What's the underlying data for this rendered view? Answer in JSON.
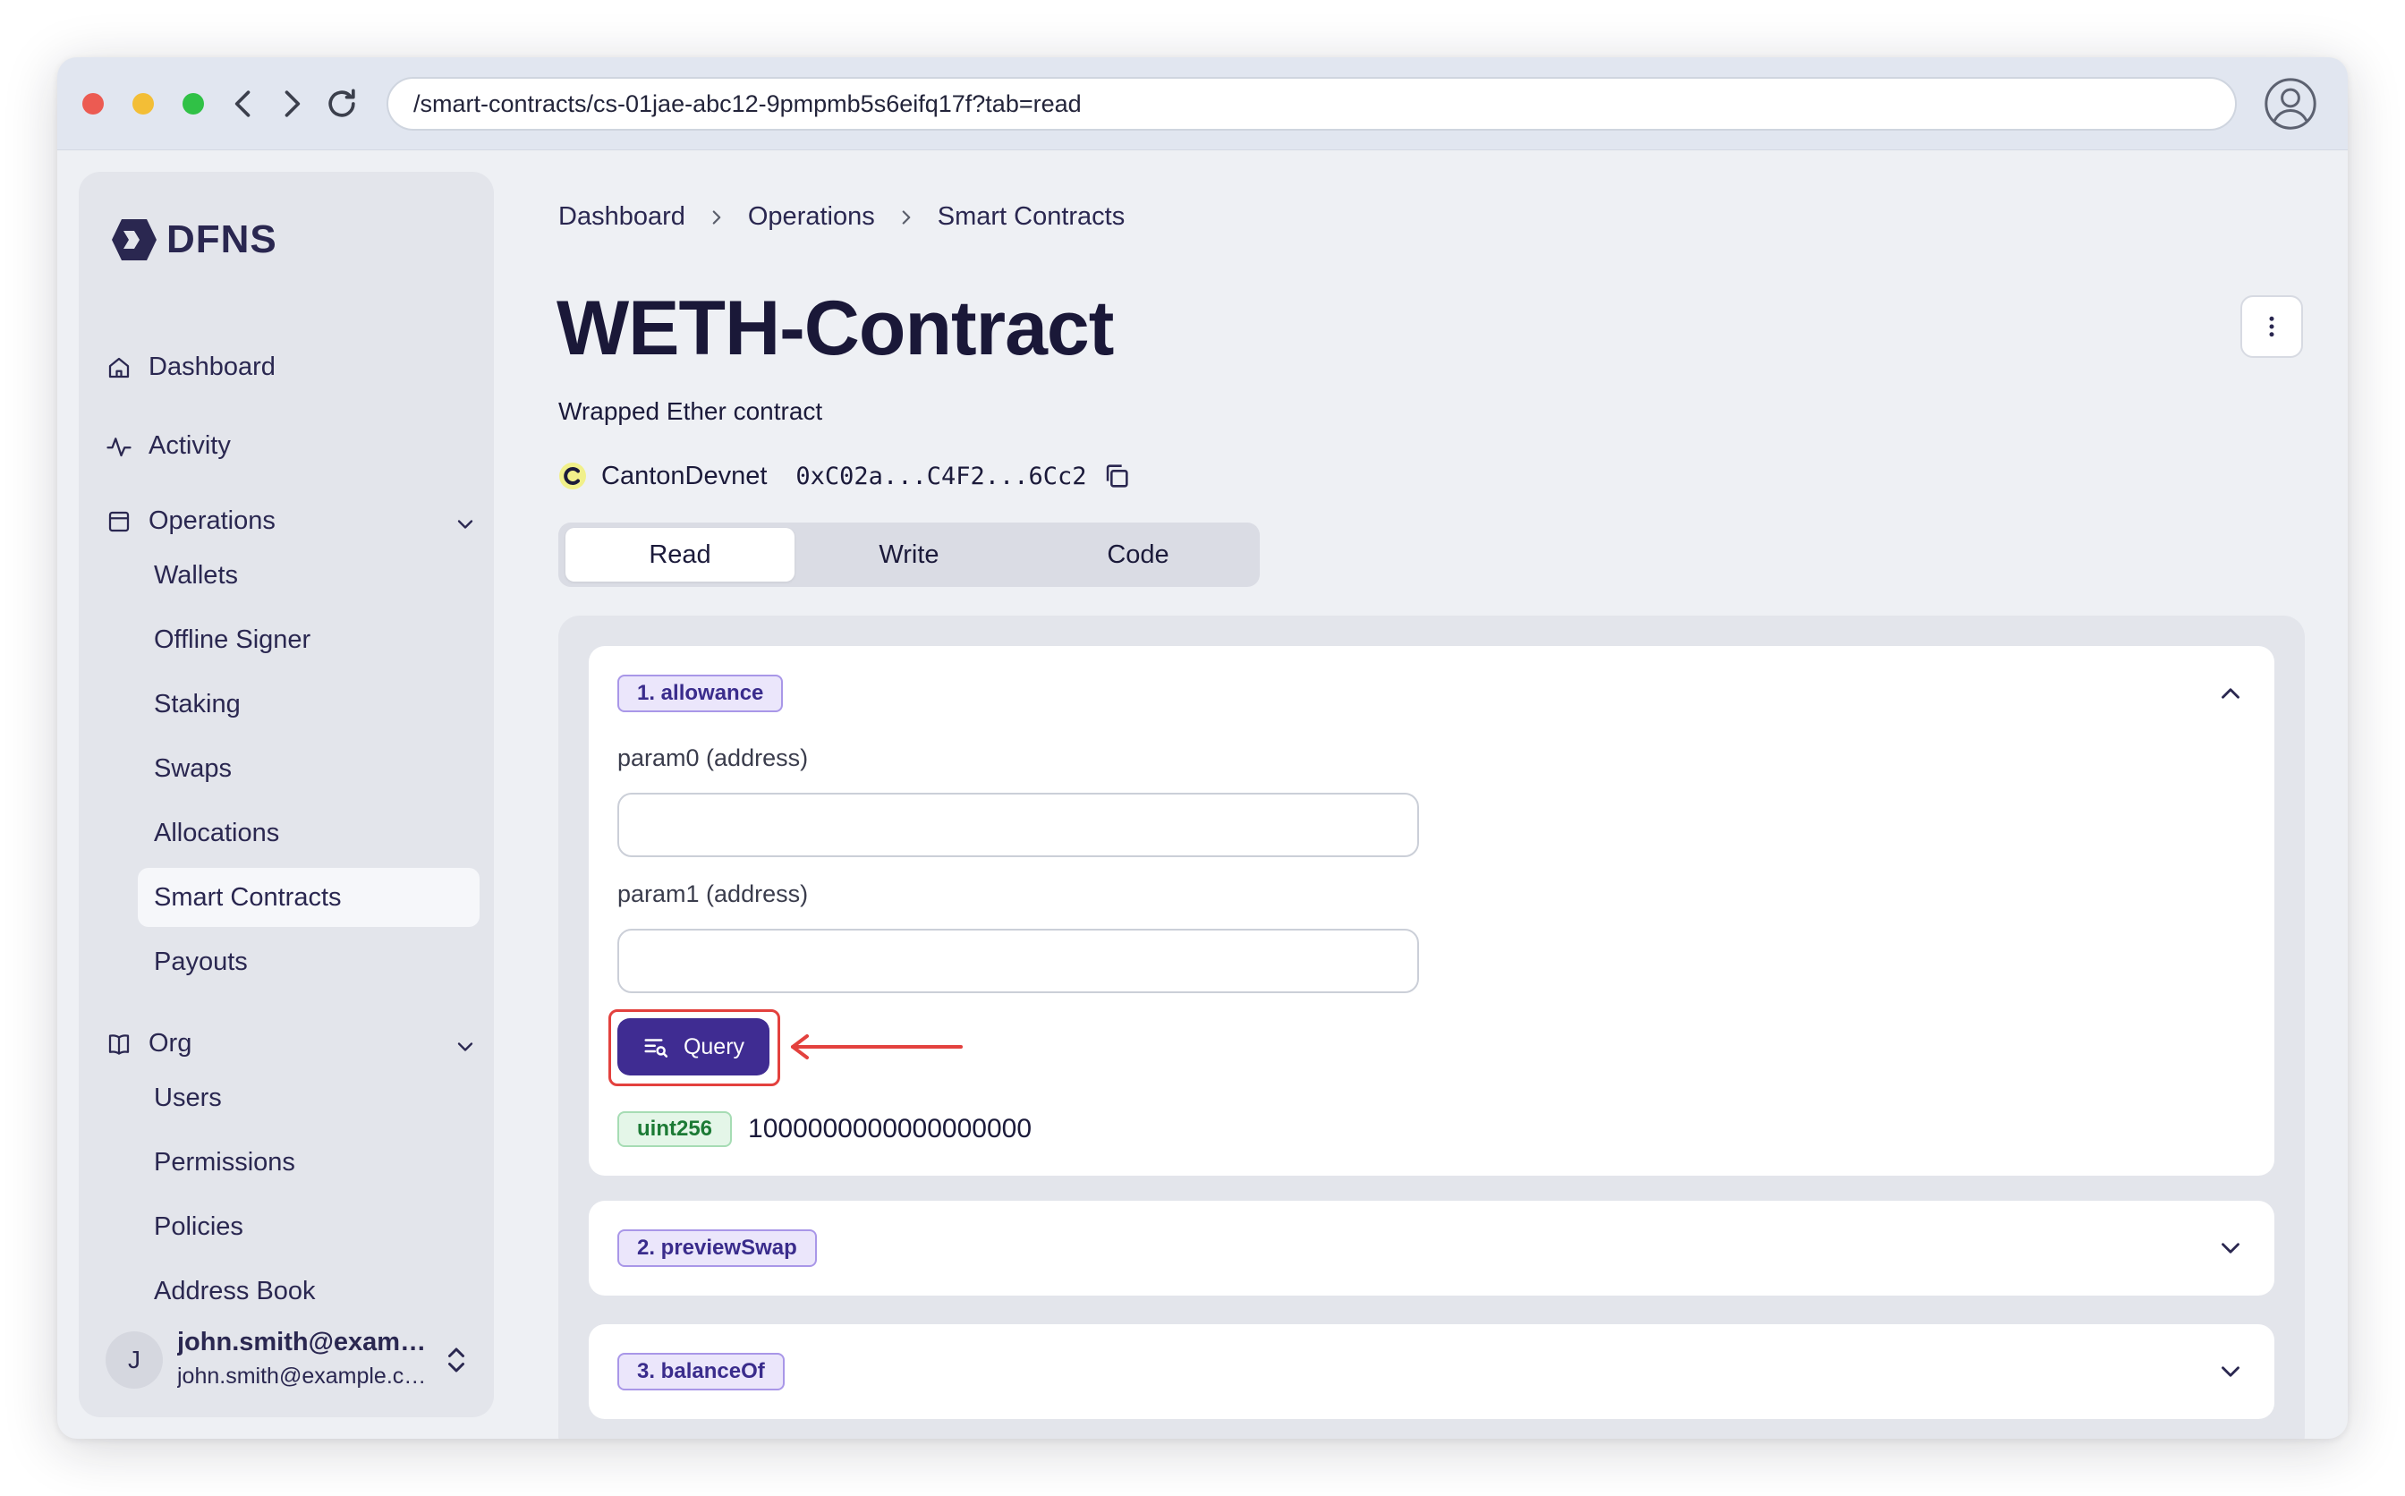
{
  "browser": {
    "url": "/smart-contracts/cs-01jae-abc12-9pmpmb5s6eifq17f?tab=read"
  },
  "sidebar": {
    "logo_text": "DFNS",
    "nav": {
      "dashboard": "Dashboard",
      "activity": "Activity",
      "operations": "Operations",
      "org": "Org"
    },
    "operations_items": [
      "Wallets",
      "Offline Signer",
      "Staking",
      "Swaps",
      "Allocations",
      "Smart Contracts",
      "Payouts"
    ],
    "active_item": "Smart Contracts",
    "org_items": [
      "Users",
      "Permissions",
      "Policies",
      "Address Book"
    ],
    "user": {
      "initial": "J",
      "name": "john.smith@example.com",
      "email": "john.smith@example.com"
    }
  },
  "breadcrumb": [
    "Dashboard",
    "Operations",
    "Smart Contracts"
  ],
  "contract": {
    "title": "WETH-Contract",
    "description": "Wrapped Ether contract",
    "network": "CantonDevnet",
    "address": "0xC02a...C4F2...6Cc2"
  },
  "tabs": [
    "Read",
    "Write",
    "Code"
  ],
  "active_tab": "Read",
  "functions": [
    {
      "label": "1. allowance",
      "expanded": true,
      "params": [
        {
          "label": "param0 (address)",
          "value": ""
        },
        {
          "label": "param1 (address)",
          "value": ""
        }
      ],
      "query_label": "Query",
      "result": {
        "type": "uint256",
        "value": "1000000000000000000"
      }
    },
    {
      "label": "2. previewSwap",
      "expanded": false
    },
    {
      "label": "3. balanceOf",
      "expanded": false
    }
  ],
  "colors": {
    "primary": "#3f2c92",
    "highlight": "#e3413e",
    "function_badge_bg": "#ebe6fb",
    "type_badge_bg": "#e4f6e8"
  }
}
